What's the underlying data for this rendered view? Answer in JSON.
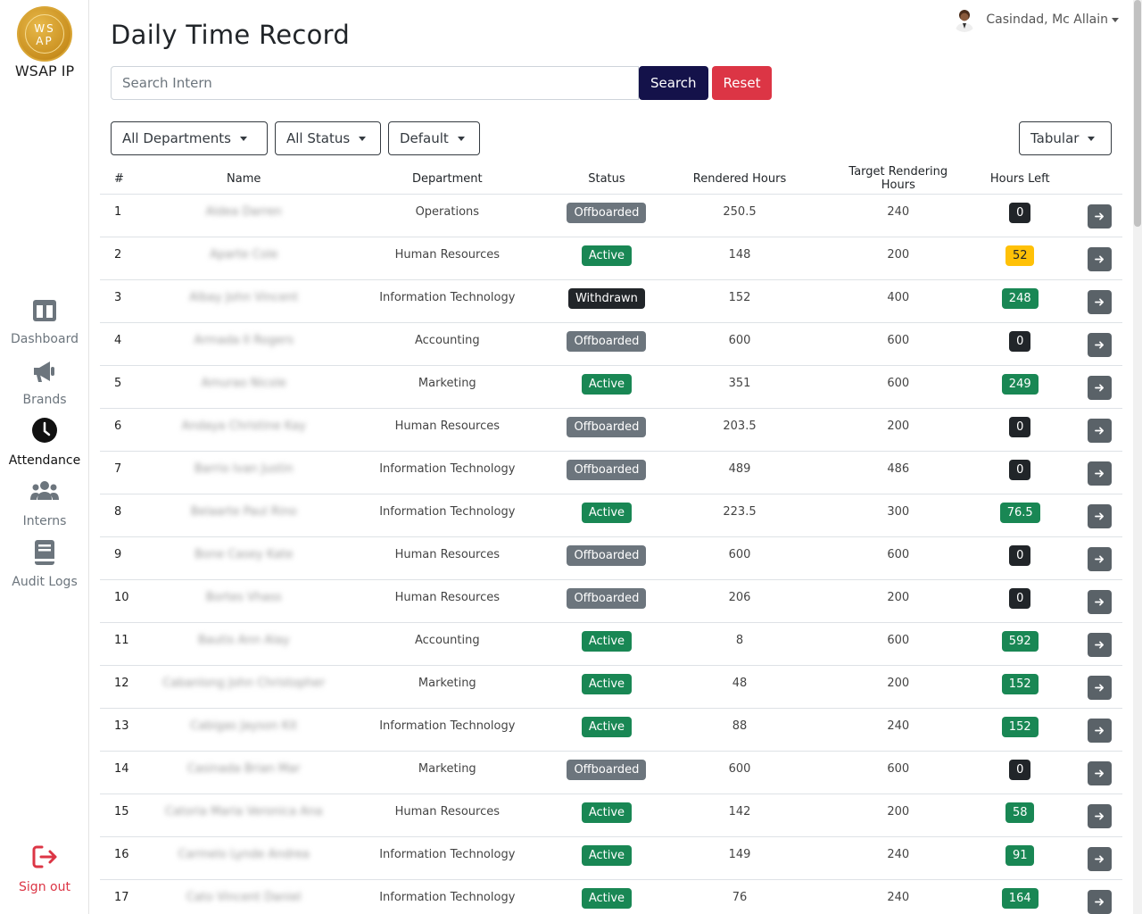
{
  "app": {
    "title": "WSAP IP",
    "logo_text": "WS AP"
  },
  "sidebar": {
    "items": [
      {
        "label": "Dashboard",
        "icon": "dashboard-icon"
      },
      {
        "label": "Brands",
        "icon": "megaphone-icon"
      },
      {
        "label": "Attendance",
        "icon": "clock-icon"
      },
      {
        "label": "Interns",
        "icon": "users-icon"
      },
      {
        "label": "Audit Logs",
        "icon": "book-icon"
      }
    ],
    "signout": "Sign out"
  },
  "header": {
    "title": "Daily Time Record",
    "user": "Casindad, Mc Allain"
  },
  "search": {
    "placeholder": "Search Intern",
    "search_label": "Search",
    "reset_label": "Reset"
  },
  "filters": {
    "department": "All Departments",
    "status": "All Status",
    "sort": "Default",
    "view": "Tabular"
  },
  "table": {
    "columns": [
      "#",
      "Name",
      "Department",
      "Status",
      "Rendered Hours",
      "Target Rendering Hours",
      "Hours Left"
    ],
    "rows": [
      {
        "n": "1",
        "name": "Aldea Darren",
        "dept": "Operations",
        "status": "Offboarded",
        "rendered": "250.5",
        "target": "240",
        "left": "0"
      },
      {
        "n": "2",
        "name": "Aparte Cole",
        "dept": "Human Resources",
        "status": "Active",
        "rendered": "148",
        "target": "200",
        "left": "52"
      },
      {
        "n": "3",
        "name": "Albay John Vincent",
        "dept": "Information Technology",
        "status": "Withdrawn",
        "rendered": "152",
        "target": "400",
        "left": "248"
      },
      {
        "n": "4",
        "name": "Armada II Rogers",
        "dept": "Accounting",
        "status": "Offboarded",
        "rendered": "600",
        "target": "600",
        "left": "0"
      },
      {
        "n": "5",
        "name": "Amurao Nicole",
        "dept": "Marketing",
        "status": "Active",
        "rendered": "351",
        "target": "600",
        "left": "249"
      },
      {
        "n": "6",
        "name": "Andaya Christine Kay",
        "dept": "Human Resources",
        "status": "Offboarded",
        "rendered": "203.5",
        "target": "200",
        "left": "0"
      },
      {
        "n": "7",
        "name": "Barrio Ivan Justin",
        "dept": "Information Technology",
        "status": "Offboarded",
        "rendered": "489",
        "target": "486",
        "left": "0"
      },
      {
        "n": "8",
        "name": "Belaarte Paul Rino",
        "dept": "Information Technology",
        "status": "Active",
        "rendered": "223.5",
        "target": "300",
        "left": "76.5"
      },
      {
        "n": "9",
        "name": "Bone Casey Kate",
        "dept": "Human Resources",
        "status": "Offboarded",
        "rendered": "600",
        "target": "600",
        "left": "0"
      },
      {
        "n": "10",
        "name": "Bortes Vhass",
        "dept": "Human Resources",
        "status": "Offboarded",
        "rendered": "206",
        "target": "200",
        "left": "0"
      },
      {
        "n": "11",
        "name": "Bautis Ann Alay",
        "dept": "Accounting",
        "status": "Active",
        "rendered": "8",
        "target": "600",
        "left": "592"
      },
      {
        "n": "12",
        "name": "Cabanlong John Christopher",
        "dept": "Marketing",
        "status": "Active",
        "rendered": "48",
        "target": "200",
        "left": "152"
      },
      {
        "n": "13",
        "name": "Cabigas Jayson Kit",
        "dept": "Information Technology",
        "status": "Active",
        "rendered": "88",
        "target": "240",
        "left": "152"
      },
      {
        "n": "14",
        "name": "Casinada Brian Mar",
        "dept": "Marketing",
        "status": "Offboarded",
        "rendered": "600",
        "target": "600",
        "left": "0"
      },
      {
        "n": "15",
        "name": "Catoria Maria Veronica Ana",
        "dept": "Human Resources",
        "status": "Active",
        "rendered": "142",
        "target": "200",
        "left": "58"
      },
      {
        "n": "16",
        "name": "Carmelo Lynde Andrea",
        "dept": "Information Technology",
        "status": "Active",
        "rendered": "149",
        "target": "240",
        "left": "91"
      },
      {
        "n": "17",
        "name": "Cato Vincent Daniel",
        "dept": "Information Technology",
        "status": "Active",
        "rendered": "76",
        "target": "240",
        "left": "164"
      }
    ]
  },
  "colors": {
    "primary": "#14124a",
    "danger": "#dc3545",
    "success": "#198754",
    "secondary": "#6c757d",
    "dark": "#212529",
    "warning": "#ffc107",
    "logo_gold": "#c98f1f"
  }
}
